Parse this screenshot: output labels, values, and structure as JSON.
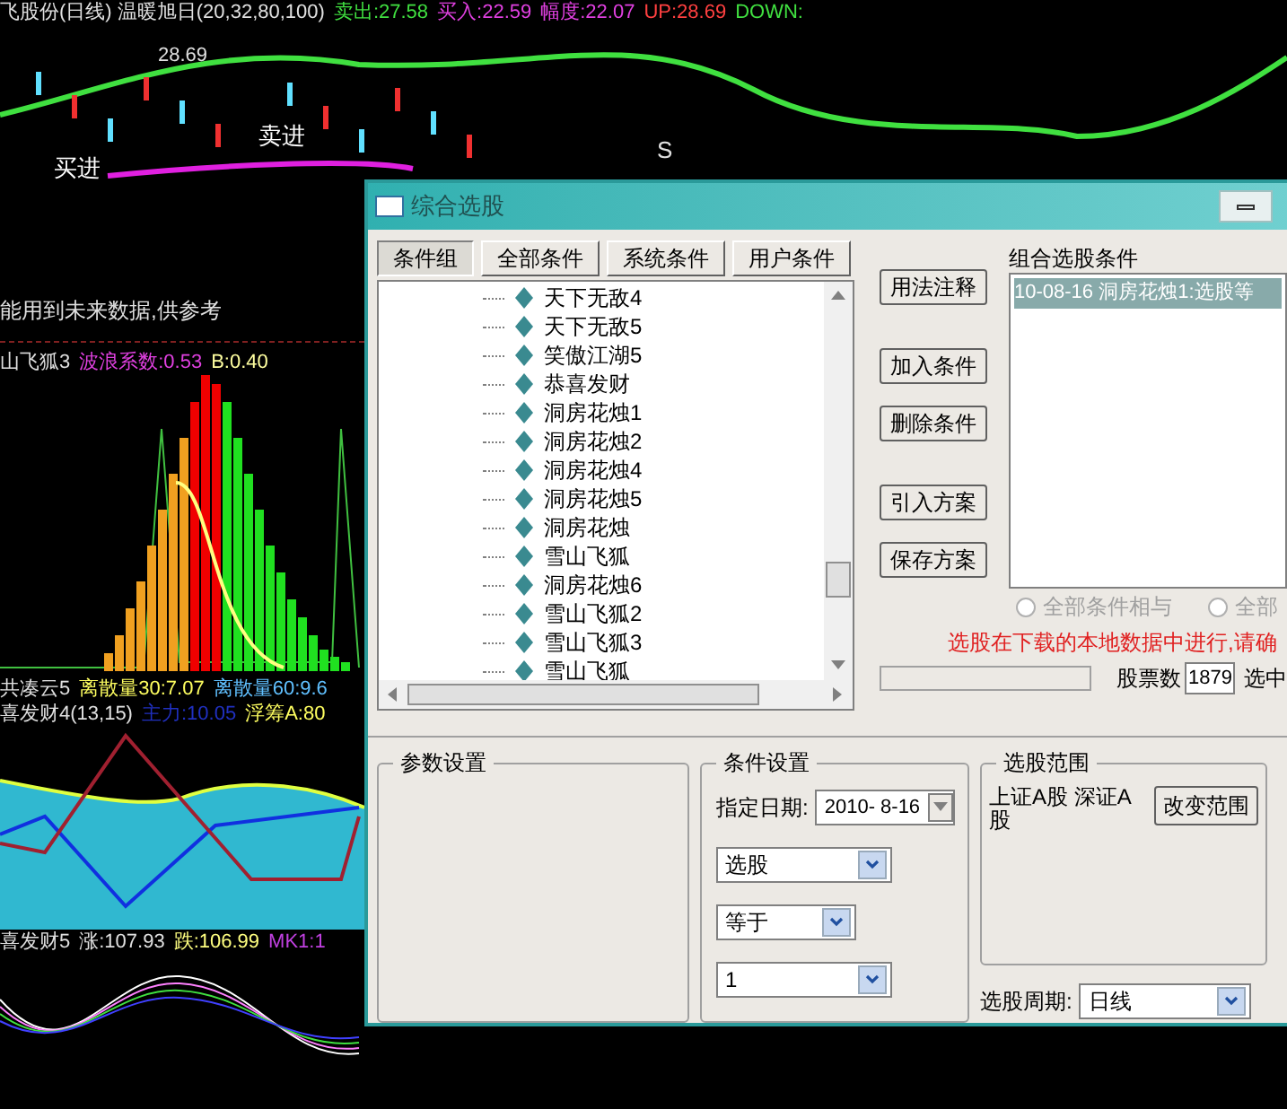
{
  "price_header": [
    {
      "text": "飞股份(日线) 温暖旭日(20,32,80,100)",
      "color": "#e0e0e0"
    },
    {
      "text": "卖出:27.58",
      "color": "#40e040"
    },
    {
      "text": "买入:22.59",
      "color": "#e040e0"
    },
    {
      "text": "幅度:22.07",
      "color": "#e040e0"
    },
    {
      "text": "UP:28.69",
      "color": "#ff4040"
    },
    {
      "text": "DOWN:",
      "color": "#40e040"
    }
  ],
  "price_chart": {
    "high_label": "28.69",
    "labels": [
      "卖进",
      "买进",
      "S"
    ]
  },
  "note": "能用到未来数据,供参考",
  "panels": [
    {
      "kind": "histogram",
      "header": [
        {
          "text": "山飞狐3",
          "color": "#e0e0e0"
        },
        {
          "text": "波浪系数:0.53",
          "color": "#e040e0"
        },
        {
          "text": "B:0.40",
          "color": "#ffffa0"
        }
      ]
    },
    {
      "kind": "area",
      "header": [
        {
          "text": "共凑云5",
          "color": "#e0e0e0"
        },
        {
          "text": "离散量30:7.07",
          "color": "#ffff60"
        },
        {
          "text": "离散量60:9.6",
          "color": "#60c0ff"
        }
      ],
      "header2": [
        {
          "text": "喜发财4(13,15)",
          "color": "#e0e0e0"
        },
        {
          "text": "主力:10.05",
          "color": "#2030c0"
        },
        {
          "text": "浮筹A:80",
          "color": "#ffff60"
        }
      ]
    },
    {
      "kind": "waves",
      "header": [
        {
          "text": "喜发财5",
          "color": "#e0e0e0"
        },
        {
          "text": "涨:107.93",
          "color": "#e0e0e0"
        },
        {
          "text": "跌:106.99",
          "color": "#ffff80"
        },
        {
          "text": "MK1:1",
          "color": "#c040e0"
        }
      ]
    }
  ],
  "dialog": {
    "title": "综合选股",
    "tabs": [
      {
        "label": "条件组",
        "selected": true
      },
      {
        "label": "全部条件",
        "selected": false
      },
      {
        "label": "系统条件",
        "selected": false
      },
      {
        "label": "用户条件",
        "selected": false
      }
    ],
    "tree": [
      {
        "label": "天下无敌4"
      },
      {
        "label": "天下无敌5"
      },
      {
        "label": "笑傲江湖5"
      },
      {
        "label": "恭喜发财"
      },
      {
        "label": "洞房花烛1"
      },
      {
        "label": "洞房花烛2"
      },
      {
        "label": "洞房花烛4"
      },
      {
        "label": "洞房花烛5"
      },
      {
        "label": "洞房花烛"
      },
      {
        "label": "雪山飞狐"
      },
      {
        "label": "洞房花烛6"
      },
      {
        "label": "雪山飞狐2"
      },
      {
        "label": "雪山飞狐3"
      },
      {
        "label": "雪山飞狐"
      }
    ],
    "buttons": [
      "用法注释",
      "加入条件",
      "删除条件",
      "引入方案",
      "保存方案"
    ],
    "combo_label": "组合选股条件",
    "combo_items": [
      {
        "text": "10-08-16 洞房花烛1:选股等",
        "selected": true
      }
    ],
    "radios": [
      {
        "label": "全部条件相与",
        "selected": false,
        "disabled": true
      },
      {
        "label": "全部",
        "selected": false,
        "disabled": true
      }
    ],
    "warning": "选股在下载的本地数据中进行,请确",
    "count_label": "股票数",
    "count_value": "1879",
    "selected_label": "选中",
    "params": {
      "title": "参数设置"
    },
    "conditions": {
      "title": "条件设置",
      "date_label": "指定日期:",
      "date_value": "2010- 8-16",
      "selects": [
        {
          "value": "选股"
        },
        {
          "value": "等于"
        },
        {
          "value": "1"
        }
      ]
    },
    "range": {
      "title": "选股范围",
      "text": "上证A股 深证A股",
      "button": "改变范围"
    },
    "period": {
      "label": "选股周期:",
      "value": "日线"
    }
  }
}
